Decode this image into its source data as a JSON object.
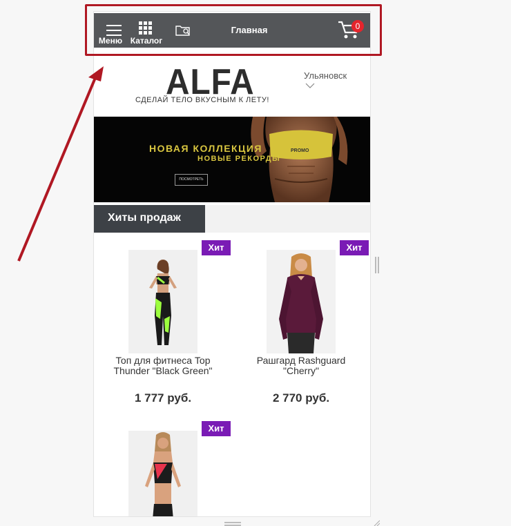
{
  "topbar": {
    "menu_label": "Меню",
    "catalog_label": "Каталог",
    "title": "Главная",
    "cart_count": "0"
  },
  "header": {
    "logo": "ALFA",
    "tagline": "СДЕЛАЙ ТЕЛО ВКУСНЫМ К ЛЕТУ!",
    "city": "Ульяновск"
  },
  "banner": {
    "line1": "НОВАЯ КОЛЛЕКЦИЯ",
    "line2": "НОВЫЕ РЕКОРДЫ",
    "button": "ПОСМОТРЕТЬ",
    "shirt_text": "PROMO"
  },
  "tabs": {
    "active": "Хиты продаж"
  },
  "products": [
    {
      "badge": "Хит",
      "name": "Топ для фитнеса Top Thunder \"Black Green\"",
      "price": "1 777 руб."
    },
    {
      "badge": "Хит",
      "name": "Рашгард Rashguard \"Cherry\"",
      "price": "2 770 руб."
    },
    {
      "badge": "Хит",
      "name": "",
      "price": ""
    }
  ],
  "colors": {
    "topbar": "#545659",
    "highlight": "#b01823",
    "hit_badge": "#7a1bb5",
    "cart_badge": "#e5252c"
  }
}
